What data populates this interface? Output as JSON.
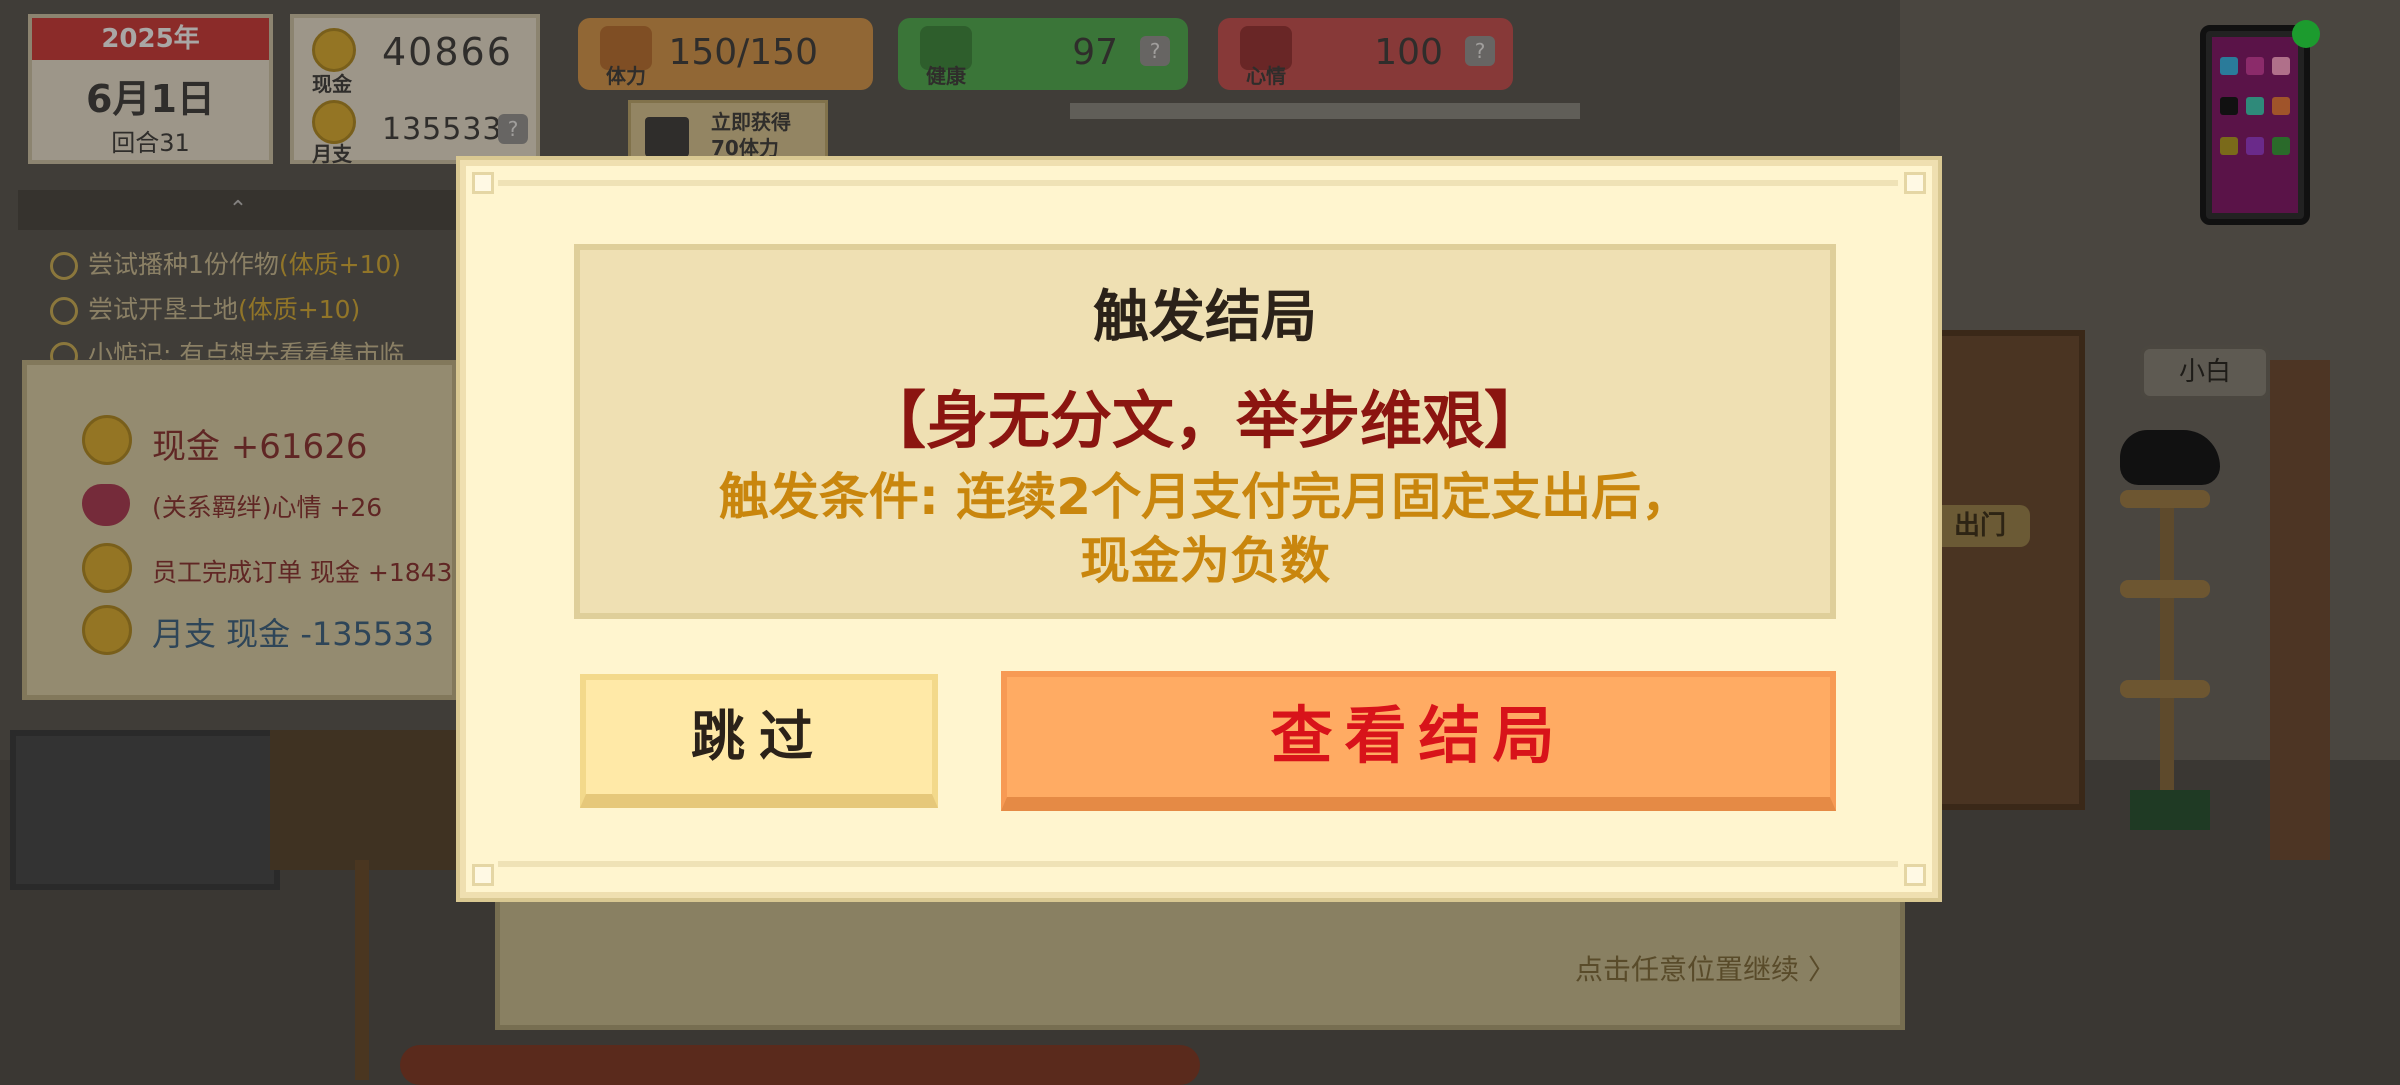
{
  "hud": {
    "year": "2025年",
    "date": "6月1日",
    "round": "回合31",
    "cash_label": "现金",
    "cash_value": "40866",
    "monthly_label": "月支",
    "monthly_value": "135533",
    "stamina_label": "体力",
    "stamina_value": "150/150",
    "health_label": "健康",
    "health_value": "97",
    "mood_label": "心情",
    "mood_value": "100",
    "help_icon": "?",
    "ad_button_label": "立即获得 70体力"
  },
  "tasks": {
    "toggle": "⌃",
    "items": [
      {
        "text": "尝试播种1份作物",
        "bonus": "(体质+10)"
      },
      {
        "text": "尝试开垦土地",
        "bonus": "(体质+10)"
      },
      {
        "text": "小惦记: 有点想去看看集市临",
        "bonus": ""
      }
    ]
  },
  "income": {
    "rows": [
      {
        "text": "现金 +61626"
      },
      {
        "text": "(关系羁绊)心情 +26"
      },
      {
        "text": "员工完成订单 现金 +1843"
      },
      {
        "text": "月支 现金 -135533"
      }
    ]
  },
  "scene": {
    "out_sign": "出门",
    "cat_name": "小白",
    "continue_hint": "点击任意位置继续 〉"
  },
  "modal": {
    "title": "触发结局",
    "ending_name": "【身无分文，举步维艰】",
    "condition_line1": "触发条件:  连续2个月支付完月固定支出后，",
    "condition_line2": "现金为负数",
    "skip_button": "跳过",
    "view_button": "查看结局"
  },
  "colors": {
    "ending_red": "#8b1510",
    "condition_gold": "#c9860d",
    "view_button_bg": "#ffab63",
    "view_button_text": "#d8131a",
    "skip_button_bg": "#ffe9a7"
  }
}
